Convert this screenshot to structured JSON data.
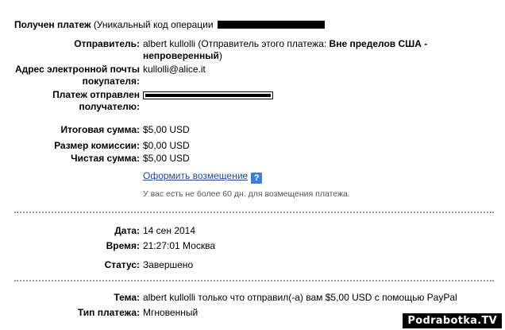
{
  "header": {
    "title": "Получен платеж",
    "subtitle": "(Уникальный код операции"
  },
  "sender": {
    "label": "Отправитель:",
    "value_prefix": "albert kullolli (Отправитель этого платежа: ",
    "value_bold": "Вне пределов США - непроверенный",
    "value_suffix": ")"
  },
  "email": {
    "label_line1": "Адрес электронной почты",
    "label_line2": "покупателя:",
    "value": "kullolli@alice.it"
  },
  "recipient": {
    "label_line1": "Платеж отправлен",
    "label_line2": "получателю:"
  },
  "totals": {
    "total_label": "Итоговая сумма:",
    "total_value": "$5,00 USD",
    "fee_label": "Размер комиссии:",
    "fee_value": "$0,00 USD",
    "net_label": "Чистая сумма:",
    "net_value": "$5,00 USD"
  },
  "refund": {
    "link_label": "Оформить возмещение",
    "help_icon": "?",
    "note": "У вас есть не более 60 дн. для возмещения платежа."
  },
  "details": {
    "date_label": "Дата:",
    "date_value": "14 сен 2014",
    "time_label": "Время:",
    "time_value": "21:27:01 Москва",
    "status_label": "Статус:",
    "status_value": "Завершено"
  },
  "subject": {
    "label": "Тема:",
    "value": "albert kullolli только что отправил(-а) вам $5,00 USD с помощью PayPal",
    "type_label": "Тип платежа:",
    "type_value": "Мгновенный"
  },
  "watermark": "Podrabotka.TV",
  "colors": {
    "link": "#1f4b8c",
    "help_icon": "#3c7ed8",
    "note": "#555555",
    "divider": "#9a9a9a"
  }
}
